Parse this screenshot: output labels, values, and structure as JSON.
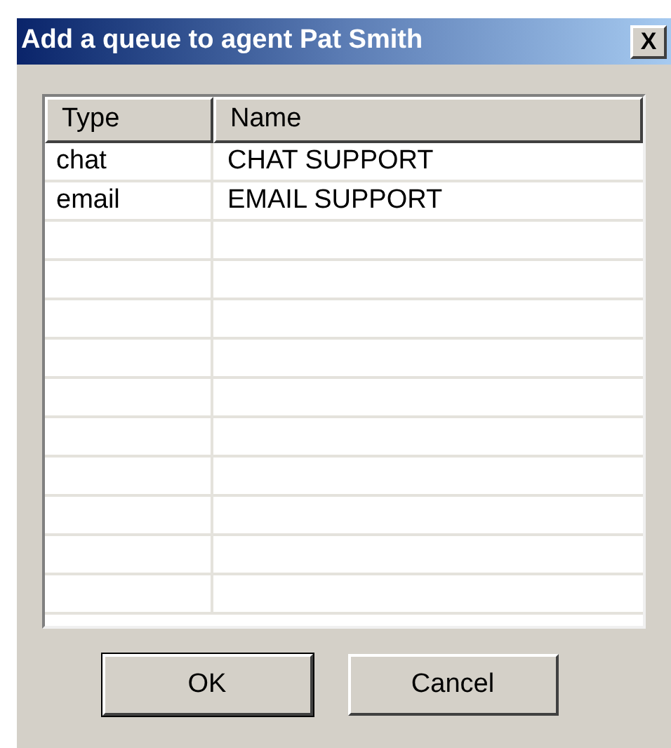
{
  "window": {
    "title": "Add a queue to agent Pat Smith",
    "close": "X"
  },
  "table": {
    "columns": [
      "Type",
      "Name"
    ],
    "rows": [
      {
        "cells": [
          "chat",
          "CHAT SUPPORT"
        ]
      },
      {
        "cells": [
          "email",
          "EMAIL SUPPORT"
        ]
      }
    ]
  },
  "buttons": [
    {
      "label": "OK",
      "default": true
    },
    {
      "label": "Cancel",
      "default": false
    }
  ]
}
